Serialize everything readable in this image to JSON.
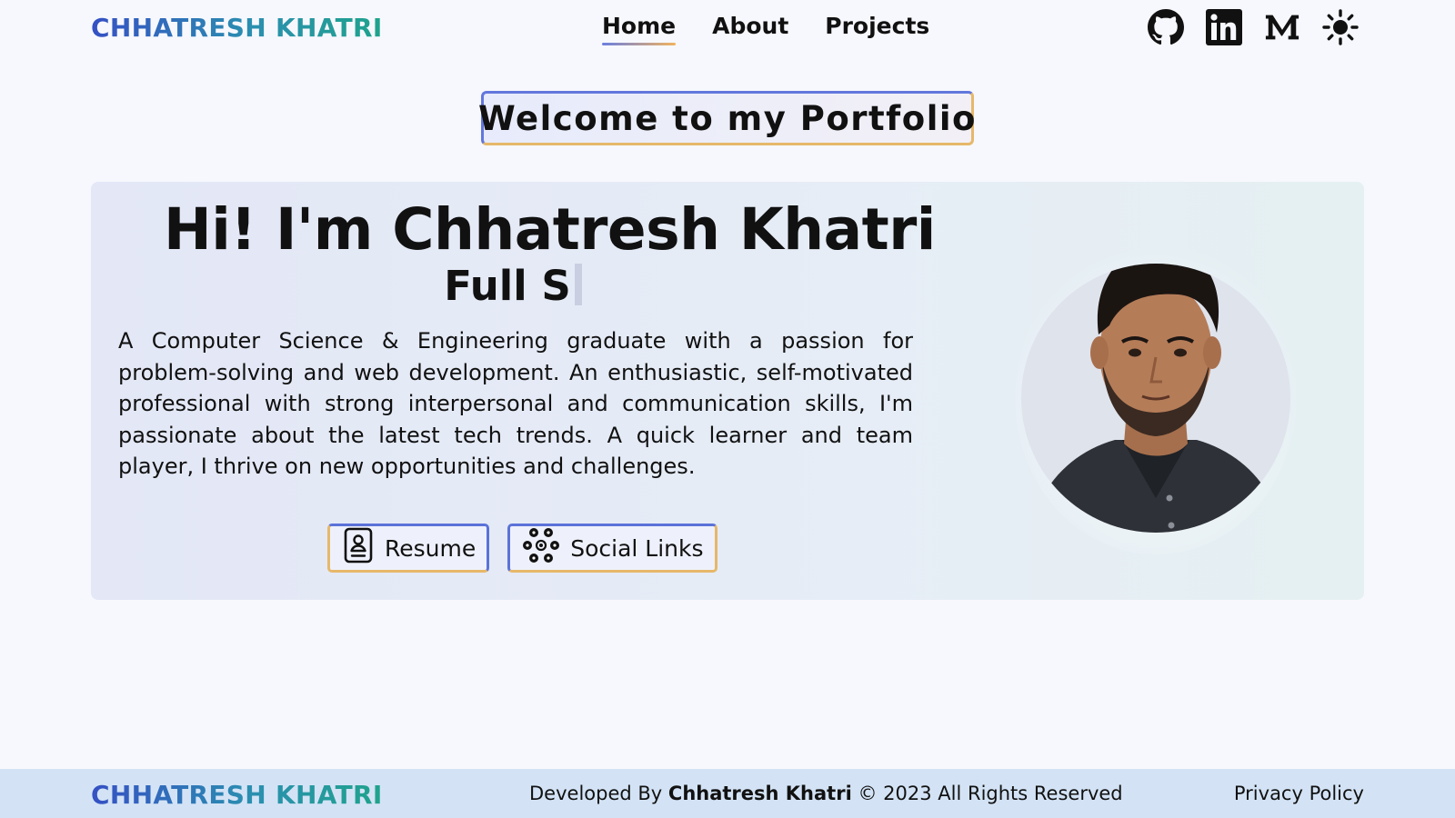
{
  "header": {
    "logo": "CHHATRESH KHATRI",
    "nav": [
      "Home",
      "About",
      "Projects"
    ],
    "active_nav": "Home",
    "icons": [
      "github-icon",
      "linkedin-icon",
      "medium-icon",
      "sun-icon"
    ]
  },
  "welcome": "Welcome to my Portfolio",
  "hero": {
    "greeting": "Hi! I'm Chhatresh Khatri",
    "role_typed": "Full S",
    "bio": "A Computer Science & Engineering graduate with a passion for problem-solving and web development. An enthusiastic, self-motivated professional with strong interpersonal and communication skills, I'm passionate about the latest tech trends. A quick learner and team player, I thrive on new opportunities and challenges.",
    "buttons": {
      "resume": "Resume",
      "social": "Social Links"
    }
  },
  "footer": {
    "logo": "CHHATRESH KHATRI",
    "credit_prefix": "Developed By",
    "credit_name": "Chhatresh Khatri",
    "credit_suffix": "© 2023 All Rights Reserved",
    "privacy": "Privacy Policy"
  },
  "colors": {
    "accent_blue": "#5b72d8",
    "accent_gold": "#e6b86a",
    "footer_bg": "#d3e3f5"
  }
}
